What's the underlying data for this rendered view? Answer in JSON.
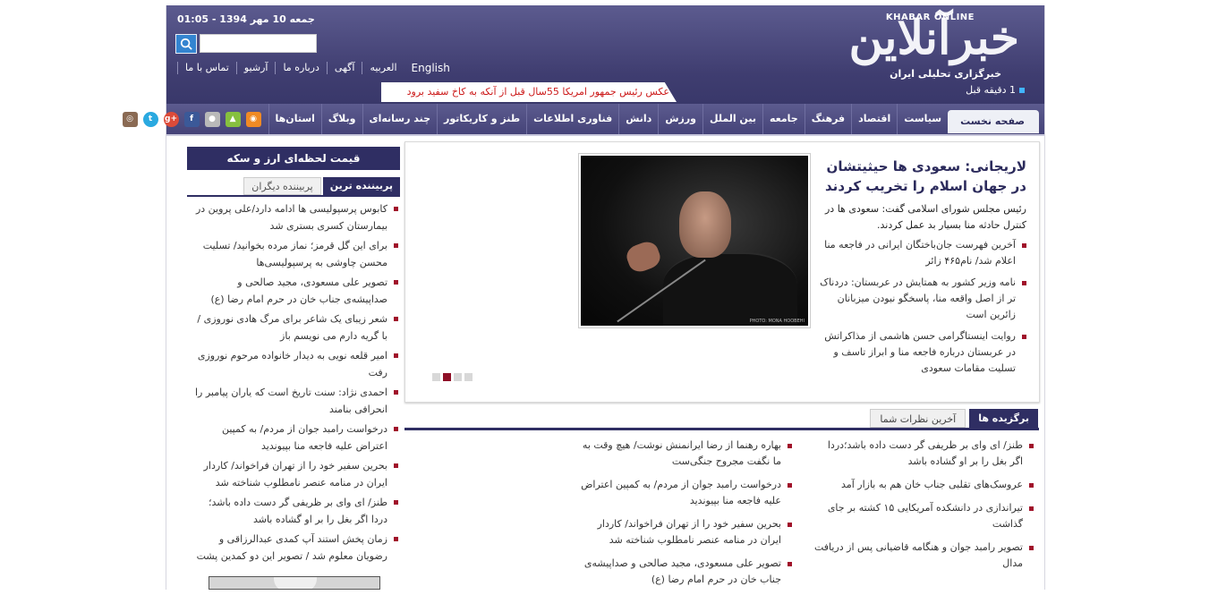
{
  "header": {
    "logo_text": "خبرآنلاین",
    "logo_latin": "KHABAR ONLINE",
    "tagline": "خبرگزاری تحلیلی ایران",
    "date": "جمعه 10 مهر 1394 - 01:05",
    "search_placeholder": "",
    "top_links": [
      "English",
      "العربیه",
      "آگهی",
      "درباره ما",
      "آرشیو",
      "تماس با ما"
    ],
    "ticker": "عکس رئیس جمهور امریکا 55سال قبل از آنکه به کاخ سفید برود",
    "time_ago": "1 دقیقه قبل"
  },
  "nav": {
    "home": "صفحه نخست",
    "items": [
      "سیاست",
      "اقتصاد",
      "فرهنگ",
      "جامعه",
      "بین الملل",
      "ورزش",
      "دانش",
      "فناوری اطلاعات",
      "طنز و کاریکاتور",
      "چند رسانه‌ای",
      "وبلاگ",
      "استان‌ها"
    ],
    "social_icons": [
      "rss-icon",
      "android-icon",
      "apple-icon",
      "facebook-icon",
      "google-plus-icon",
      "twitter-icon",
      "instagram-icon"
    ],
    "colors": {
      "rss": "#f08a24",
      "android": "#86c03f",
      "apple": "#b9b9b9",
      "facebook": "#3b5998",
      "google_plus": "#dd4b39",
      "twitter": "#2aa9e0",
      "instagram": "#8a6a53"
    }
  },
  "sidebar": {
    "price_title": "قیمت لحظه‌ای ارز و سکه",
    "tabs": [
      "پربیننده ترین",
      "پربیننده دیگران"
    ],
    "items": [
      "کابوس پرسپولیسی ها ادامه دارد/علی پروین در بیمارستان کسری بستری شد",
      "برای این گل قرمز؛ نماز مرده بخوانید/ تسلیت محسن چاوشی به پرسپولیسی‌ها",
      "تصویر علی مسعودی، مجید صالحی و صداپیشه‌ی جناب خان در حرم امام رضا (ع)",
      "شعر زیبای یک شاعر برای مرگ هادی نوروزی / با گریه دارم می نویسم باز",
      "امیر قلعه نویی به دیدار خانواده مرحوم نوروزی رفت",
      "احمدی نژاد: سنت تاریخ است که یاران پیامبر را انحرافی بنامند",
      "درخواست رامبد جوان از مردم/ به کمپین اعتراض علیه فاجعه منا بپیوندید",
      "بحرین سفیر خود را از تهران فراخواند/ کاردار ایران در منامه عنصر نامطلوب شناخته شد",
      "طنز/ ای وای بر ظریفی گر دست داده باشد؛دردا اگر بغل را بر او گشاده باشد",
      "زمان پخش استند آپ کمدی عبدالرزاقی و رضویان معلوم شد / تصویر این دو کمدین پشت صحنه‌ی خندوانه"
    ]
  },
  "main": {
    "headline": "لاریجانی: سعودی ها حیثیتشان در جهان اسلام را تخریب کردند",
    "lead": "رئیس مجلس شورای اسلامی گفت: سعودی ها در کنترل حادثه منا بسیار بد عمل کردند.",
    "related": [
      "آخرین فهرست جان‌باختگان ایرانی در فاجعه منا اعلام شد/ نام۴۶۵ زائر",
      "نامه وزیر کشور به همتایش در عربستان: دردناک تر از اصل واقعه منا، پاسخگو نبودن میزبانان زائرین است",
      "روایت اینستاگرامی حسن هاشمی از مذاکراتش در عربستان درباره فاجعه منا و ابراز تاسف و تسلیت مقامات سعودی"
    ],
    "photo_credit": "PHOTO: MONA HOOBEHI",
    "slider_count": 4,
    "slider_active": 2
  },
  "featured": {
    "tabs": [
      "برگزیده ها",
      "آخرین نظرات شما"
    ],
    "col_right": [
      "طنز/ ای وای بر ظریفی گر دست داده باشد؛دردا اگر بغل را بر او گشاده باشد",
      "عروسک‌های تقلبی جناب خان هم به بازار آمد",
      "تیراندازی در دانشکده آمریکایی ۱۵ کشته بر جای گذاشت",
      "تصویر رامبد جوان و هنگامه قاضیانی پس از دریافت مدال"
    ],
    "col_mid": [
      "بهاره رهنما از رضا ایرانمنش نوشت/ هیچ وقت به ما نگفت مجروح جنگی‌ست",
      "درخواست رامبد جوان از مردم/ به کمپین اعتراض علیه فاجعه منا بپیوندید",
      "بحرین سفیر خود را از تهران فراخواند/ کاردار ایران در منامه عنصر نامطلوب شناخته شد",
      "تصویر علی مسعودی، مجید صالحی و صداپیشه‌ی جناب خان در حرم امام رضا (ع)"
    ]
  }
}
